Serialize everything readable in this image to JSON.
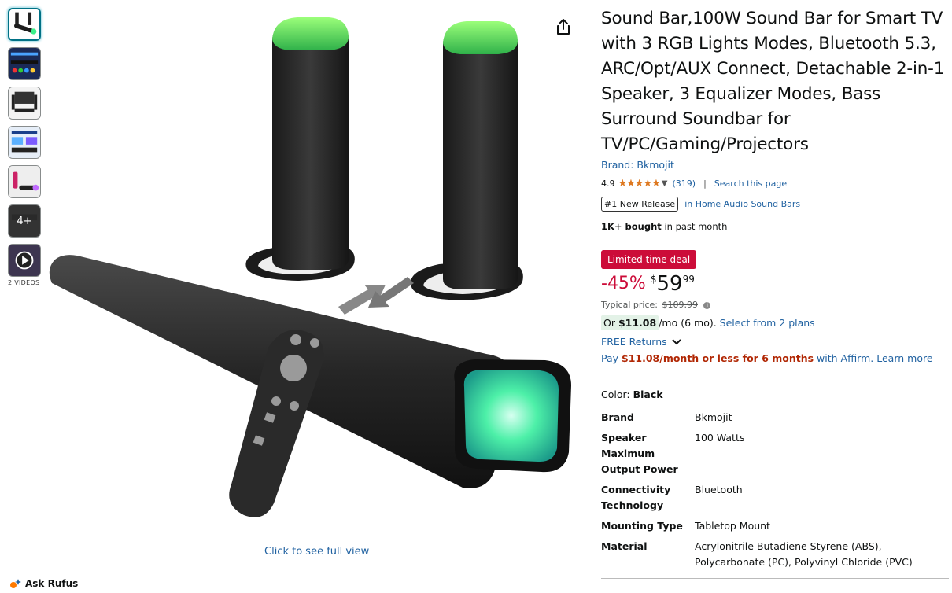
{
  "title": "Sound Bar,100W Sound Bar for Smart TV with 3 RGB Lights Modes, Bluetooth 5.3, ARC/Opt/AUX Connect, Detachable 2-in-1 Speaker, 3 Equalizer Modes, Bass Surround Soundbar for TV/PC/Gaming/Projectors",
  "brand_link": "Brand: Bkmojit",
  "rating": {
    "value": "4.9",
    "stars": "★★★★★",
    "count": "(319)",
    "search_link": "Search this page"
  },
  "badge": {
    "label": "#1 New Release",
    "category": "in Home Audio Sound Bars"
  },
  "bought": {
    "bold": "1K+ bought",
    "rest": " in past month"
  },
  "deal": {
    "label": "Limited time deal"
  },
  "price": {
    "discount": "-45%",
    "symbol": "$",
    "whole": "59",
    "fraction": "99",
    "typical_label": "Typical price:",
    "typical_value": "$109.99"
  },
  "monthly": {
    "or": "Or ",
    "amount": "$11.08",
    "rest": "/mo (6 mo). ",
    "plans_link": "Select from 2 plans"
  },
  "returns": {
    "label": "FREE Returns"
  },
  "affirm": {
    "pre": "Pay ",
    "amount": "$11.08/month or less for 6 months",
    "mid": " with Affirm. ",
    "learn": "Learn more"
  },
  "color": {
    "label": "Color: ",
    "value": "Black"
  },
  "specs": [
    {
      "key": "Brand",
      "value": "Bkmojit"
    },
    {
      "key": "Speaker Maximum Output Power",
      "value": "100 Watts"
    },
    {
      "key": "Connectivity Technology",
      "value": "Bluetooth"
    },
    {
      "key": "Mounting Type",
      "value": "Tabletop Mount"
    },
    {
      "key": "Material",
      "value": "Acrylonitrile Butadiene Styrene (ABS), Polycarbonate (PC), Polyvinyl Chloride (PVC)"
    }
  ],
  "thumbnails": {
    "more_label": "4+",
    "videos_label": "2 VIDEOS"
  },
  "full_view": "Click to see full view",
  "rufus": "Ask Rufus",
  "colors": {
    "link": "#2162a1",
    "deal": "#cc0c39",
    "star": "#de7921",
    "glow": "#3cf08a"
  }
}
